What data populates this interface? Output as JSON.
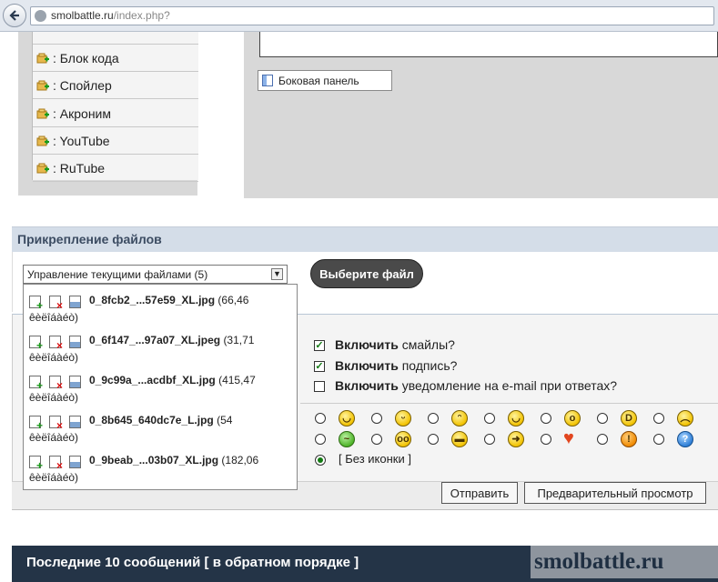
{
  "browser": {
    "url_host": "smolbattle.ru",
    "url_path": "/index.php?"
  },
  "bbcode_list": [
    ": Блок кода",
    ": Спойлер",
    ": Акроним",
    ": YouTube",
    ": RuTube"
  ],
  "side_panel_button": "Боковая панель",
  "attachments": {
    "title": "Прикрепление файлов",
    "select_value": "Управление текущими файлами (5)",
    "choose_button": "Выберите файл",
    "files": [
      {
        "name": "0_8fcb2_...57e59_XL.jpg",
        "size": "(66,46",
        "unit": "êèëîáàéò)"
      },
      {
        "name": "0_6f147_...97a07_XL.jpeg",
        "size": "(31,71",
        "unit": "êèëîáàéò)"
      },
      {
        "name": "0_9c99a_...acdbf_XL.jpg",
        "size": "(415,47",
        "unit": "êèëîáàéò)"
      },
      {
        "name": "0_8b645_640dc7e_L.jpg",
        "size": "(54",
        "unit": "êèëîáàéò)"
      },
      {
        "name": "0_9beab_...03b07_XL.jpg",
        "size": "(182,06",
        "unit": "êèëîáàéò)"
      }
    ]
  },
  "options": [
    {
      "bold": "Включить",
      "rest": " смайлы?",
      "checked": true
    },
    {
      "bold": "Включить",
      "rest": " подпись?",
      "checked": true
    },
    {
      "bold": "Включить",
      "rest": " уведомление на e-mail при ответах?",
      "checked": false
    }
  ],
  "post_icons": {
    "no_icon_label": "[ Без иконки ]",
    "selected": "none"
  },
  "buttons": {
    "submit": "Отправить",
    "preview": "Предварительный просмотр"
  },
  "footer": {
    "title": "Последние 10 сообщений [ в обратном порядке ]",
    "watermark": "smolbattle.ru"
  }
}
